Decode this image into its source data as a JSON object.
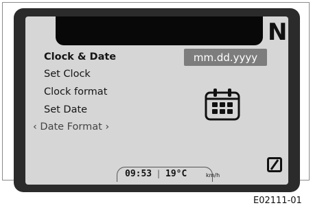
{
  "display": {
    "gear_indicator": "N",
    "menu": {
      "header": "Clock & Date",
      "items": [
        {
          "label": "Set Clock"
        },
        {
          "label": "Clock format"
        },
        {
          "label": "Set Date"
        },
        {
          "label": "‹ Date Format ›"
        }
      ]
    },
    "date_format_value": "mm.dd.yyyy",
    "icon": "calendar-icon",
    "status_bar": {
      "time": "09:53",
      "separator": "|",
      "temperature": "19°C",
      "speed_unit": "km/h"
    },
    "corner_icon": "zero-slash-icon"
  },
  "caption": "E02111-01"
}
